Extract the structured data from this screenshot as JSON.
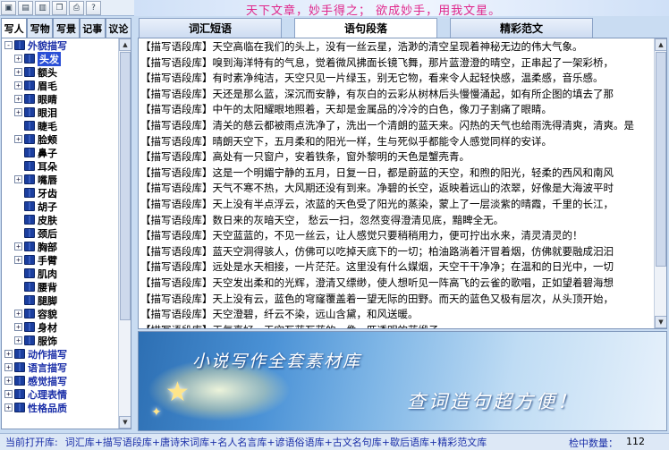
{
  "toolbar": {
    "buttons": [
      "open-icon",
      "folder-icon",
      "save-icon",
      "copy-icon",
      "print-icon",
      "help-icon"
    ],
    "help_glyph": "?"
  },
  "slogan": "天下文章，妙手得之；  欲成妙手，用我文星。",
  "side_tabs": [
    "写人",
    "写物",
    "写景",
    "记事",
    "议论"
  ],
  "tree": [
    {
      "label": "外貌描写",
      "level": 0,
      "expander": "-",
      "style": "blue"
    },
    {
      "label": "头发",
      "level": 1,
      "expander": "+",
      "style": "sel"
    },
    {
      "label": "额头",
      "level": 1,
      "expander": "+",
      "style": ""
    },
    {
      "label": "眉毛",
      "level": 1,
      "expander": "+",
      "style": ""
    },
    {
      "label": "眼睛",
      "level": 1,
      "expander": "+",
      "style": ""
    },
    {
      "label": "眼泪",
      "level": 1,
      "expander": "+",
      "style": ""
    },
    {
      "label": "睫毛",
      "level": 1,
      "expander": "",
      "style": ""
    },
    {
      "label": "脸颊",
      "level": 1,
      "expander": "+",
      "style": ""
    },
    {
      "label": "鼻子",
      "level": 1,
      "expander": "",
      "style": ""
    },
    {
      "label": "耳朵",
      "level": 1,
      "expander": "",
      "style": ""
    },
    {
      "label": "嘴唇",
      "level": 1,
      "expander": "+",
      "style": ""
    },
    {
      "label": "牙齿",
      "level": 1,
      "expander": "",
      "style": ""
    },
    {
      "label": "胡子",
      "level": 1,
      "expander": "",
      "style": ""
    },
    {
      "label": "皮肤",
      "level": 1,
      "expander": "",
      "style": ""
    },
    {
      "label": "颈后",
      "level": 1,
      "expander": "",
      "style": ""
    },
    {
      "label": "胸部",
      "level": 1,
      "expander": "+",
      "style": ""
    },
    {
      "label": "手臂",
      "level": 1,
      "expander": "+",
      "style": ""
    },
    {
      "label": "肌肉",
      "level": 1,
      "expander": "",
      "style": ""
    },
    {
      "label": "腰背",
      "level": 1,
      "expander": "",
      "style": ""
    },
    {
      "label": "腿脚",
      "level": 1,
      "expander": "",
      "style": ""
    },
    {
      "label": "容貌",
      "level": 1,
      "expander": "+",
      "style": ""
    },
    {
      "label": "身材",
      "level": 1,
      "expander": "+",
      "style": ""
    },
    {
      "label": "服饰",
      "level": 1,
      "expander": "+",
      "style": ""
    },
    {
      "label": "动作描写",
      "level": 0,
      "expander": "+",
      "style": "blue"
    },
    {
      "label": "语言描写",
      "level": 0,
      "expander": "+",
      "style": "blue"
    },
    {
      "label": "感觉描写",
      "level": 0,
      "expander": "+",
      "style": "blue"
    },
    {
      "label": "心理表情",
      "level": 0,
      "expander": "+",
      "style": "blue"
    },
    {
      "label": "性格品质",
      "level": 0,
      "expander": "+",
      "style": "blue"
    }
  ],
  "main_tabs": [
    "词汇短语",
    "语句段落",
    "精彩范文"
  ],
  "lines": [
    "【描写语段库】天空高临在我们的头上，没有一丝云星，浩渺的清空呈现着神秘无边的伟大气象。",
    "【描写语段库】嗅到海洋特有的气息，觉着微风拂面长镜飞舞，那片蓝澄澄的晴空，正串起了一架彩桥，",
    "【描写语段库】有时素净纯洁，天空只见一片绿玉，别无它物，看来令人起轻快感，温柔感，音乐感。",
    "【描写语段库】天还是那么蓝，深沉而安静，有灰白的云彩从树林后头慢慢涌起，如有所企图的填去了那",
    "【描写语段库】中午的太阳耀眼地照着，天却是金属品的冷冷的白色，像刀子割痛了眼睛。",
    "【描写语段库】清关的慈云都被雨点洗净了，洗出一个清朗的蓝天来。闪热的天气也给雨洗得清爽，清爽。是",
    "【描写语段库】晴朗天空下，五月柔和的阳光一样，生与死似乎都能令人感觉同样的安详。",
    "【描写语段库】高处有一只窗户，安着铁条，窗外黎明的天色是蟹壳青。",
    "【描写语段库】这是一个明媚宁静的五月，日复一日，都是蔚蓝的天空，和煦的阳光，轻柔的西风和南风",
    "【描写语段库】天气不寒不热，大风期还没有到来。净碧的长空，返映着远山的浓翠，好像是大海波平时",
    "【描写语段库】天上没有半点浮云，浓蓝的天色受了阳光的蒸染，蒙上了一层淡紫的晴霞，千里的长江，",
    "【描写语段库】数日来的灰暗天空，  愁云一扫，忽然变得澄清见底，黯睥全无。",
    "【描写语段库】天空蓝蓝的，不见一丝云，让人感觉只要稍稍用力，便可拧出水来，清灵清灵的！",
    "【描写语段库】蓝天空洞得骇人，仿佛可以吃掉天底下的一切；柏油路淌着汗冒着烟，仿佛就要融成汩汩",
    "【描写语段库】远处是水天相接，一片茫茫。这里没有什么媒烟，天空干干净净；在温和的日光中，一切",
    "【描写语段库】天空发出柔和的光辉，澄清又缥缈，使人想听见一阵高飞的云雀的歌唱，正如望着碧海想",
    "【描写语段库】天上没有云，蓝色的穹窿覆盖着一望无际的田野。而天的蓝色又极有层次，从头顶开始，",
    "【描写语段库】天空澄碧，纤云不染，远山含黛，和风送暖。",
    "【描写语段库】天气真好，天空瓦蓝瓦蓝的，像一匹透明的蓝缎子。"
  ],
  "preview": {
    "promo1": "小说写作全套素材库",
    "promo2": "查词造句超方便！"
  },
  "status": {
    "label": "当前打开库:",
    "libs": "词汇库+描写语段库+唐诗宋词库+名人名言库+谚语俗语库+古文名句库+歇后语库+精彩范文库",
    "count_label": "检中数量：",
    "count": "112"
  },
  "colors": {
    "accent": "#2a4fd6",
    "slogan": "#e0268b",
    "label_blue": "#1b2fa8"
  }
}
